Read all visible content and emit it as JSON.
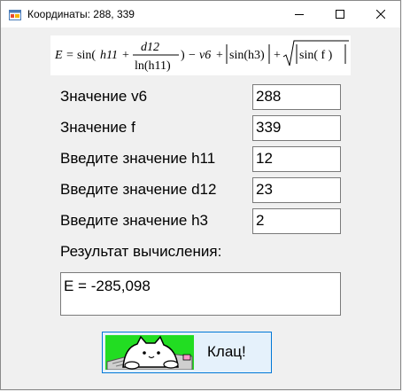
{
  "window": {
    "title": "Координаты: 288, 339",
    "icon": "app-window-icon",
    "controls": [
      "minimize-icon",
      "maximize-icon",
      "close-icon"
    ]
  },
  "formula": {
    "lhs": "E",
    "equals": "=",
    "sin1": "sin(",
    "h11": "h11",
    "plus": "+",
    "num": "d12",
    "den": "ln(h11)",
    "close1": ")",
    "minus": "−",
    "v6": "v6",
    "plus2": "+",
    "abs": "sin(h3)",
    "plus3": "+",
    "sqrt_inner": "sin( f )"
  },
  "fields": [
    {
      "label": "Значение v6",
      "value": "288"
    },
    {
      "label": "Значение f",
      "value": "339"
    },
    {
      "label": "Введите значение h11",
      "value": "12"
    },
    {
      "label": "Введите значение d12",
      "value": "23"
    },
    {
      "label": "Введите значение h3",
      "value": "2"
    }
  ],
  "result": {
    "label": "Результат вычисления:",
    "value": "E = -285,098"
  },
  "button": {
    "label": "Клац!",
    "image": "bongo-cat-image",
    "image_bg": "#22dd22"
  },
  "colors": {
    "accent": "#0078d7",
    "button_bg": "#e5f1fb"
  }
}
